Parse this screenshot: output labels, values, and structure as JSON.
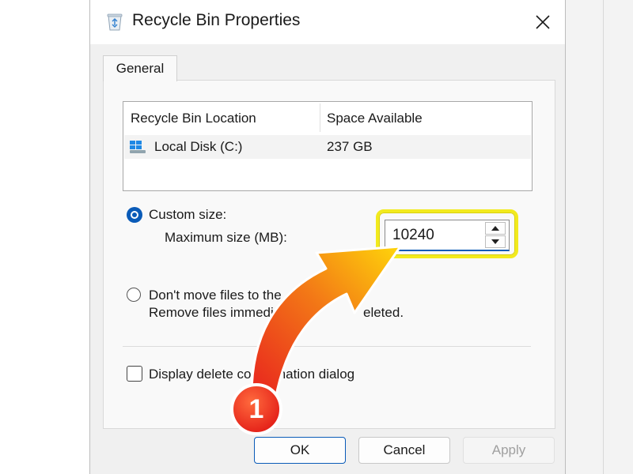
{
  "window": {
    "title": "Recycle Bin Properties",
    "close_icon": "close-icon",
    "app_icon": "recycle-bin-icon"
  },
  "tabs": [
    {
      "label": "General",
      "selected": true
    }
  ],
  "location_list": {
    "headers": [
      "Recycle Bin Location",
      "Space Available"
    ],
    "rows": [
      {
        "icon": "windows-drive-icon",
        "name": "Local Disk (C:)",
        "space": "237 GB",
        "selected": true
      }
    ]
  },
  "options": {
    "custom_size": {
      "label": "Custom size:",
      "checked": true,
      "max_size_label": "Maximum size (MB):",
      "max_size_value": "10240"
    },
    "dont_move": {
      "label_line1_visible": "Don't move files to the",
      "label_line2_visible_start": "Remove files immedi",
      "label_line2_visible_end": "eleted.",
      "checked": false
    },
    "display_confirmation": {
      "label_visible_start": "Display delete co",
      "label_visible_end": "mation dialog",
      "checked": false
    }
  },
  "buttons": {
    "ok": "OK",
    "cancel": "Cancel",
    "apply": "Apply"
  },
  "annotation": {
    "step_number": "1",
    "highlight_color": "#f2ea1d",
    "arrow_color_start": "#e8211f",
    "arrow_color_end": "#ffd60a"
  },
  "colors": {
    "accent": "#0a5bb8",
    "dialog_bg": "#f0f0f0"
  }
}
